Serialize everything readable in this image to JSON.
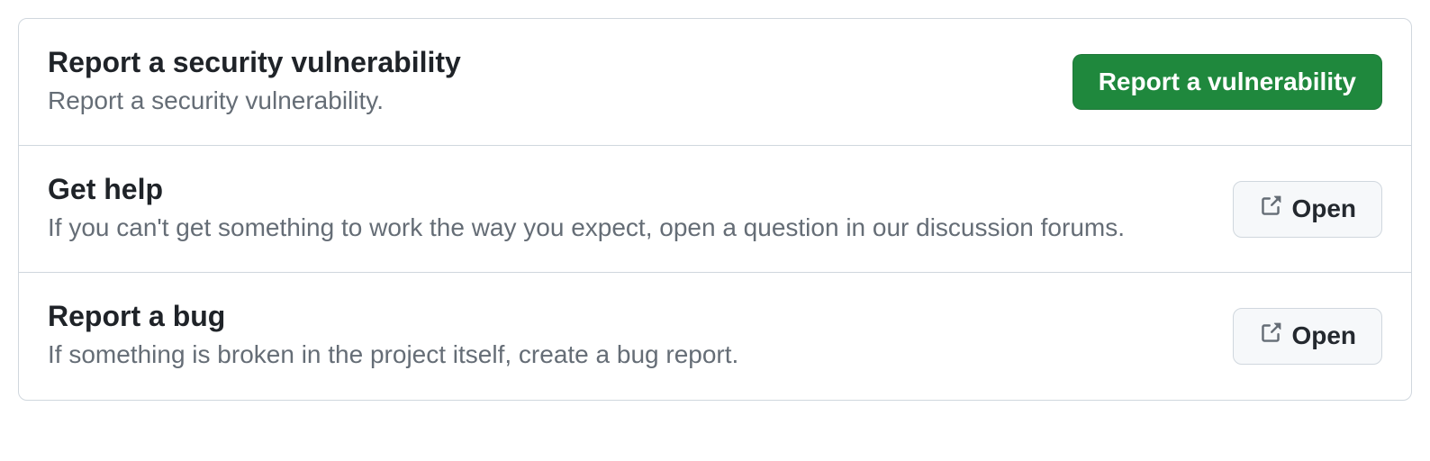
{
  "items": [
    {
      "title": "Report a security vulnerability",
      "description": "Report a security vulnerability.",
      "button": {
        "label": "Report a vulnerability",
        "style": "primary",
        "external": false
      }
    },
    {
      "title": "Get help",
      "description": "If you can't get something to work the way you expect, open a question in our discussion forums.",
      "button": {
        "label": "Open",
        "style": "secondary",
        "external": true
      }
    },
    {
      "title": "Report a bug",
      "description": "If something is broken in the project itself, create a bug report.",
      "button": {
        "label": "Open",
        "style": "secondary",
        "external": true
      }
    }
  ]
}
